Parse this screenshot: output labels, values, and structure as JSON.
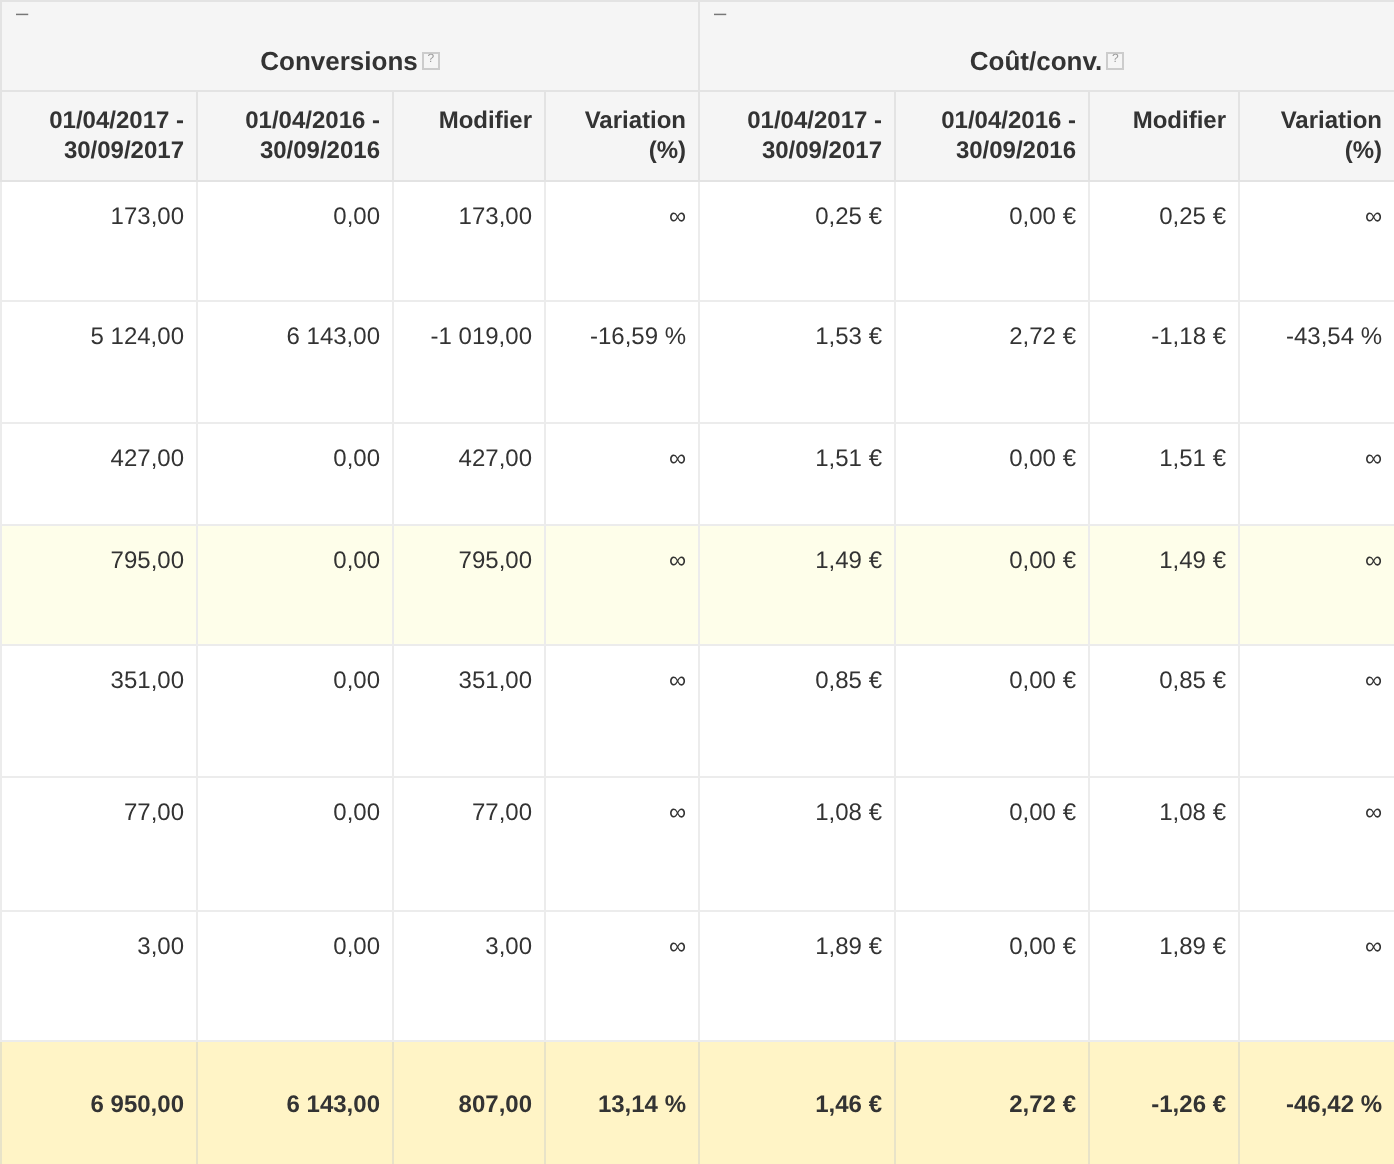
{
  "groups": [
    {
      "collapse": "–",
      "title": "Conversions",
      "help": "?"
    },
    {
      "collapse": "–",
      "title": "Coût/conv.",
      "help": "?"
    }
  ],
  "columns": [
    "01/04/2017 - 30/09/2017",
    "01/04/2016 - 30/09/2016",
    "Modifier",
    "Variation (%)",
    "01/04/2017 - 30/09/2017",
    "01/04/2016 - 30/09/2016",
    "Modifier",
    "Variation (%)"
  ],
  "rows": [
    {
      "highlighted": false,
      "cells": [
        "173,00",
        "0,00",
        "173,00",
        "∞",
        "0,25 €",
        "0,00 €",
        "0,25 €",
        "∞"
      ]
    },
    {
      "highlighted": false,
      "cells": [
        "5 124,00",
        "6 143,00",
        "-1 019,00",
        "-16,59 %",
        "1,53 €",
        "2,72 €",
        "-1,18 €",
        "-43,54 %"
      ]
    },
    {
      "highlighted": false,
      "cells": [
        "427,00",
        "0,00",
        "427,00",
        "∞",
        "1,51 €",
        "0,00 €",
        "1,51 €",
        "∞"
      ]
    },
    {
      "highlighted": true,
      "cells": [
        "795,00",
        "0,00",
        "795,00",
        "∞",
        "1,49 €",
        "0,00 €",
        "1,49 €",
        "∞"
      ]
    },
    {
      "highlighted": false,
      "cells": [
        "351,00",
        "0,00",
        "351,00",
        "∞",
        "0,85 €",
        "0,00 €",
        "0,85 €",
        "∞"
      ]
    },
    {
      "highlighted": false,
      "cells": [
        "77,00",
        "0,00",
        "77,00",
        "∞",
        "1,08 €",
        "0,00 €",
        "1,08 €",
        "∞"
      ]
    },
    {
      "highlighted": false,
      "cells": [
        "3,00",
        "0,00",
        "3,00",
        "∞",
        "1,89 €",
        "0,00 €",
        "1,89 €",
        "∞"
      ]
    }
  ],
  "total": [
    "6 950,00",
    "6 143,00",
    "807,00",
    "13,14 %",
    "1,46 €",
    "2,72 €",
    "-1,26 €",
    "-46,42 %"
  ]
}
